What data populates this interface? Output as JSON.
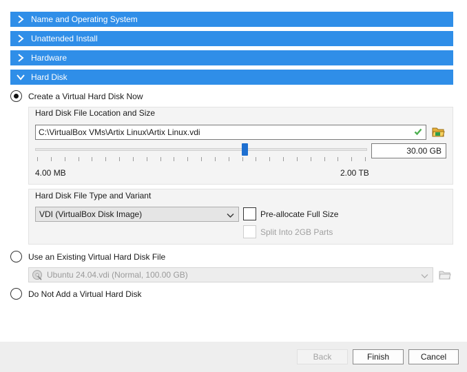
{
  "sections": [
    {
      "label": "Name and Operating System",
      "state": "collapsed"
    },
    {
      "label": "Unattended Install",
      "state": "collapsed"
    },
    {
      "label": "Hardware",
      "state": "collapsed"
    },
    {
      "label": "Hard Disk",
      "state": "expanded"
    }
  ],
  "hard_disk": {
    "option_create": "Create a Virtual Hard Disk Now",
    "location_group_title": "Hard Disk File Location and Size",
    "file_path": "C:\\VirtualBox VMs\\Artix Linux\\Artix Linux.vdi",
    "size_value": "30.00 GB",
    "size_min_label": "4.00 MB",
    "size_max_label": "2.00 TB",
    "slider_position": 0.63,
    "type_group_title": "Hard Disk File Type and Variant",
    "file_type": "VDI (VirtualBox Disk Image)",
    "preallocate_label": "Pre-allocate Full Size",
    "preallocate_checked": false,
    "split_label": "Split Into 2GB Parts",
    "split_checked": false,
    "split_enabled": false,
    "option_existing": "Use an Existing Virtual Hard Disk File",
    "existing_disk": "Ubuntu 24.04.vdi (Normal, 100.00 GB)",
    "option_none": "Do Not Add a Virtual Hard Disk",
    "selected_option": "create"
  },
  "footer": {
    "back_label": "Back",
    "finish_label": "Finish",
    "cancel_label": "Cancel"
  },
  "colors": {
    "section_bar": "#2f8ee8",
    "slider_handle": "#1e6fd0",
    "valid_check": "#4caf50",
    "folder_icon": "#e8b13a"
  }
}
